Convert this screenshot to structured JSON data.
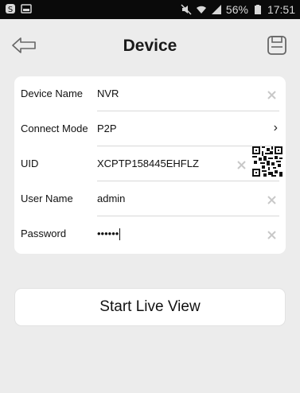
{
  "status_bar": {
    "battery": "56%",
    "time": "17:51"
  },
  "header": {
    "title": "Device"
  },
  "form": {
    "device_name": {
      "label": "Device Name",
      "value": "NVR"
    },
    "connect_mode": {
      "label": "Connect Mode",
      "value": "P2P"
    },
    "uid": {
      "label": "UID",
      "value": "XCPTP158445EHFLZ"
    },
    "user_name": {
      "label": "User Name",
      "value": "admin"
    },
    "password": {
      "label": "Password",
      "value": "••••••"
    }
  },
  "actions": {
    "start_live_view": "Start Live View"
  },
  "icons": {
    "back": "back-arrow-icon",
    "save": "save-icon",
    "clear": "clear-icon",
    "qr": "qr-code-icon",
    "chevron": "chevron-right-icon"
  }
}
